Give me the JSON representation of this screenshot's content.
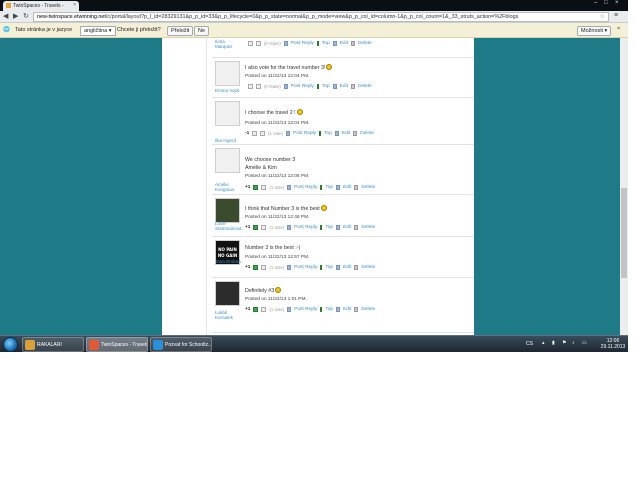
{
  "browser": {
    "tab_title": "TwinSpaces - Travels -",
    "tab_close": "×",
    "window_controls": [
      "–",
      "□",
      "×"
    ],
    "nav_icons": [
      "arrow-left-icon",
      "arrow-right-icon",
      "reload-icon"
    ],
    "url_host": "new-twinspace.etwinning.net",
    "url_rest": "/c/portal/layout?p_l_id=28329131&p_p_id=33&p_p_lifecycle=0&p_p_state=normal&p_p_mode=view&p_p_col_id=column-1&p_p_col_count=1&_33_struts_action=%2Fblogs",
    "menu_icon": "≡"
  },
  "translate_bar": {
    "prompt": "Tato stránka je v jazyce",
    "language": "angličtina ▾",
    "question": "Chcete ji přeložit?",
    "translate_button": "Přeložit",
    "no_button": "Ne",
    "options_button": "Možnosti ▾",
    "close": "×"
  },
  "posts": [
    {
      "author": "Ilona Marquez",
      "message": "",
      "posted": "",
      "votes_prefix": "",
      "vote_count": "",
      "votes_label": "(0 Votes)",
      "post_reply": "Post Reply",
      "top": "Top",
      "edit": "Edit",
      "delete": "Delete",
      "smiley": false
    },
    {
      "author": "Emma Vojtit",
      "message": "I also vote for the travel number 3!",
      "posted": "Posted on 11/22/13 12:04 PM.",
      "vote_count": "",
      "votes_label": "(0 Votes)",
      "post_reply": "Post Reply",
      "top": "Top",
      "edit": "Edit",
      "delete": "Delete",
      "smiley": true
    },
    {
      "author": "Ilka Ingerd",
      "message": "I choose the travel 2 !",
      "posted": "Posted on 11/22/13 12:04 PM.",
      "vote_count": "-1",
      "votes_label": "(1 Vote)",
      "post_reply": "Post Reply",
      "top": "Top",
      "edit": "Edit",
      "delete": "Delete",
      "smiley": true
    },
    {
      "author": "Amélie Kongraus",
      "message": "We choose number 3",
      "message2": "Amélie & Kim",
      "posted": "Posted on 11/22/13 12:06 PM.",
      "vote_count": "+1",
      "votes_label": "(1 Vote)",
      "post_reply": "Post Reply",
      "top": "Top",
      "edit": "Edit",
      "delete": "Delete",
      "smiley": false
    },
    {
      "author": "Lucie Stammanová",
      "message": "I think that Number 3 is the best",
      "posted": "Posted on 11/22/13 12:48 PM.",
      "vote_count": "+1",
      "votes_label": "(1 Vote)",
      "post_reply": "Post Reply",
      "top": "Top",
      "edit": "Edit",
      "delete": "Delete",
      "smiley": true
    },
    {
      "author": "Jana Drobná",
      "message": "Number 3 is the best :-)",
      "posted": "Posted on 11/22/13 12:57 PM.",
      "vote_count": "+1",
      "votes_label": "(1 Vote)",
      "post_reply": "Post Reply",
      "top": "Top",
      "edit": "Edit",
      "delete": "Delete",
      "smiley": false,
      "avatar_text": "NO PAIN NO GAIN"
    },
    {
      "author": "Lukáš Kornatek",
      "message": "Definitely #3",
      "posted": "Posted on 11/22/13 1:01 PM.",
      "vote_count": "+1",
      "votes_label": "(1 Vote)",
      "post_reply": "Post Reply",
      "top": "Top",
      "edit": "Edit",
      "delete": "Delete",
      "smiley": true
    }
  ],
  "taskbar": {
    "items": [
      {
        "label": "RAKALARI",
        "color": "#d9a13a"
      },
      {
        "label": "TwinSpaces - Travels...",
        "color": "#e05a3a"
      },
      {
        "label": "Pozvat for Schooltz...",
        "color": "#2a8fd6"
      }
    ],
    "tray_lang": "CS",
    "time": "12:06",
    "date": "29.11.2013"
  }
}
